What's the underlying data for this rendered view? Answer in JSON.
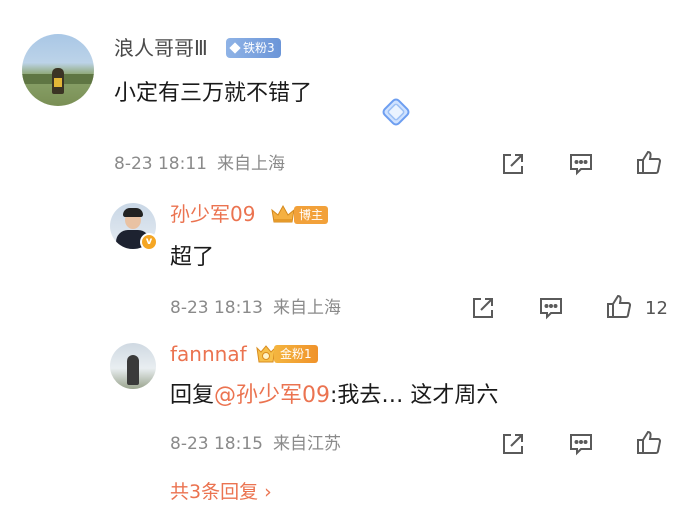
{
  "comment": {
    "author": "浪人哥哥Ⅲ",
    "fan_badge": "铁粉3",
    "text": "小定有三万就不错了",
    "date": "8-23 18:11",
    "location": "来自上海",
    "share_icon": "share-icon",
    "reply_icon": "comment-icon",
    "like_icon": "like-icon"
  },
  "replies": [
    {
      "author": "孙少军09",
      "role_badge": "博主",
      "text": "超了",
      "date": "8-23 18:13",
      "location": "来自上海",
      "like_count": "12",
      "verified_badge": "v"
    },
    {
      "author": "fannnaf",
      "fan_badge": "金粉1",
      "reply_prefix": "回复",
      "mention": "@孙少军09",
      "text": ":我去… 这才周六",
      "date": "8-23 18:15",
      "location": "来自江苏"
    }
  ],
  "more_replies": "共3条回复 ›",
  "colors": {
    "accent": "#eb7350",
    "meta_gray": "#8a8a8a",
    "iron_badge": "#7aa1dd",
    "gold_badge": "#f2a13a"
  }
}
